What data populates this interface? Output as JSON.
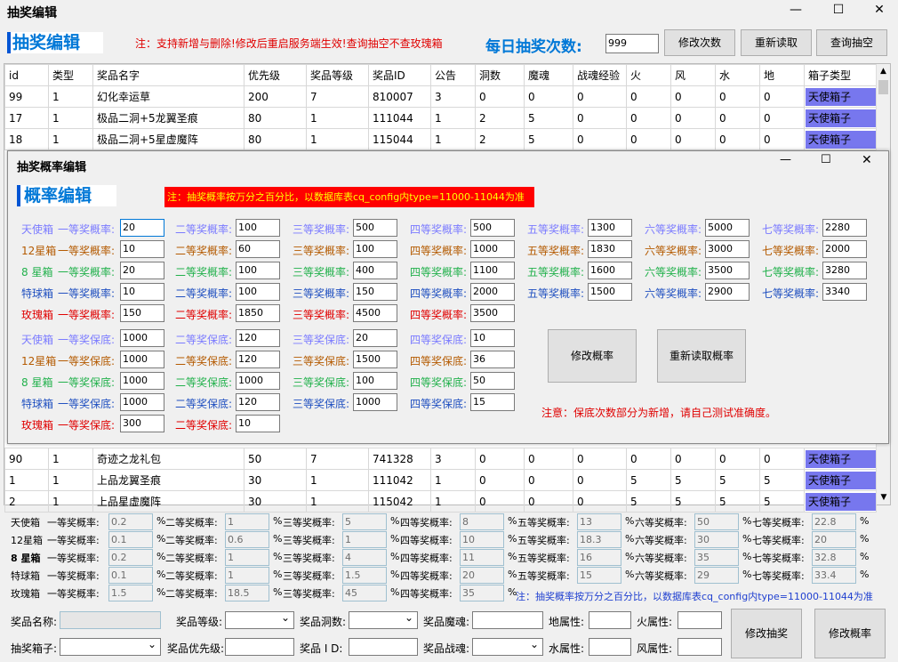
{
  "window": {
    "title": "抽奖编辑"
  },
  "top": {
    "heading": "抽奖编辑",
    "note": "注：支持新增与删除!修改后重启服务端生效!查询抽空不查玫瑰箱",
    "daily_label": "每日抽奖次数:",
    "daily_value": "999",
    "btn_modify": "修改次数",
    "btn_reload": "重新读取",
    "btn_query": "查询抽空"
  },
  "table": {
    "headers": [
      "id",
      "类型",
      "奖品名字",
      "优先级",
      "奖品等级",
      "奖品ID",
      "公告",
      "洞数",
      "魔魂",
      "战魂经验",
      "火",
      "风",
      "水",
      "地",
      "箱子类型"
    ],
    "rows_top": [
      [
        "99",
        "1",
        "幻化幸运草",
        "200",
        "7",
        "810007",
        "3",
        "0",
        "0",
        "0",
        "0",
        "0",
        "0",
        "0",
        "天使箱子"
      ],
      [
        "17",
        "1",
        "极品二洞+5龙翼圣痕",
        "80",
        "1",
        "111044",
        "1",
        "2",
        "5",
        "0",
        "0",
        "0",
        "0",
        "0",
        "天使箱子"
      ],
      [
        "18",
        "1",
        "极品二洞+5星虚魔阵",
        "80",
        "1",
        "115044",
        "1",
        "2",
        "5",
        "0",
        "0",
        "0",
        "0",
        "0",
        "天使箱子"
      ]
    ],
    "rows_bottom": [
      [
        "90",
        "1",
        "奇迹之龙礼包",
        "50",
        "7",
        "741328",
        "3",
        "0",
        "0",
        "0",
        "0",
        "0",
        "0",
        "0",
        "天使箱子"
      ],
      [
        "1",
        "1",
        "上品龙翼圣痕",
        "30",
        "1",
        "111042",
        "1",
        "0",
        "0",
        "0",
        "5",
        "5",
        "5",
        "5",
        "天使箱子"
      ],
      [
        "2",
        "1",
        "上品星虚魔阵",
        "30",
        "1",
        "115042",
        "1",
        "0",
        "0",
        "0",
        "5",
        "5",
        "5",
        "5",
        "天使箱子"
      ]
    ]
  },
  "dialog": {
    "title": "抽奖概率编辑",
    "heading": "概率编辑",
    "note": "注：抽奖概率按万分之百分比，以数据库表cq_config内type=11000-11044为准",
    "rows": [
      {
        "box": "天使箱",
        "cls": "c-tianshi",
        "labels": [
          "一等奖概率:",
          "二等奖概率:",
          "三等奖概率:",
          "四等奖概率:",
          "五等奖概率:",
          "六等奖概率:",
          "七等奖概率:"
        ],
        "values": [
          "20",
          "100",
          "500",
          "500",
          "1300",
          "5000",
          "2280"
        ]
      },
      {
        "box": "12星箱",
        "cls": "c-12",
        "labels": [
          "一等奖概率:",
          "二等奖概率:",
          "三等奖概率:",
          "四等奖概率:",
          "五等奖概率:",
          "六等奖概率:",
          "七等奖概率:"
        ],
        "values": [
          "10",
          "60",
          "100",
          "1000",
          "1830",
          "3000",
          "2000"
        ]
      },
      {
        "box": "8 星箱",
        "cls": "c-8",
        "labels": [
          "一等奖概率:",
          "二等奖概率:",
          "三等奖概率:",
          "四等奖概率:",
          "五等奖概率:",
          "六等奖概率:",
          "七等奖概率:"
        ],
        "values": [
          "20",
          "100",
          "400",
          "1100",
          "1600",
          "3500",
          "3280"
        ]
      },
      {
        "box": "特球箱",
        "cls": "c-teqiu",
        "labels": [
          "一等奖概率:",
          "二等奖概率:",
          "三等奖概率:",
          "四等奖概率:",
          "五等奖概率:",
          "六等奖概率:",
          "七等奖概率:"
        ],
        "values": [
          "10",
          "100",
          "150",
          "2000",
          "1500",
          "2900",
          "3340"
        ]
      },
      {
        "box": "玫瑰箱",
        "cls": "c-meigui",
        "labels": [
          "一等奖概率:",
          "二等奖概率:",
          "三等奖概率:",
          "四等奖概率:"
        ],
        "values": [
          "150",
          "1850",
          "4500",
          "3500"
        ]
      }
    ],
    "floor_rows": [
      {
        "box": "天使箱",
        "cls": "c-tianshi",
        "labels": [
          "一等奖保底:",
          "二等奖保底:",
          "三等奖保底:",
          "四等奖保底:"
        ],
        "values": [
          "1000",
          "120",
          "20",
          "10"
        ]
      },
      {
        "box": "12星箱",
        "cls": "c-12",
        "labels": [
          "一等奖保底:",
          "二等奖保底:",
          "三等奖保底:",
          "四等奖保底:"
        ],
        "values": [
          "1000",
          "120",
          "1500",
          "36"
        ]
      },
      {
        "box": "8 星箱",
        "cls": "c-8",
        "labels": [
          "一等奖保底:",
          "二等奖保底:",
          "三等奖保底:",
          "四等奖保底:"
        ],
        "values": [
          "1000",
          "1000",
          "100",
          "50"
        ]
      },
      {
        "box": "特球箱",
        "cls": "c-teqiu",
        "labels": [
          "一等奖保底:",
          "二等奖保底:",
          "三等奖保底:",
          "四等奖保底:"
        ],
        "values": [
          "1000",
          "120",
          "1000",
          "15"
        ]
      },
      {
        "box": "玫瑰箱",
        "cls": "c-meigui",
        "labels": [
          "一等奖保底:",
          "二等奖保底:"
        ],
        "values": [
          "300",
          "10"
        ]
      }
    ],
    "btn_modify": "修改概率",
    "btn_reload": "重新读取概率",
    "floor_note": "注意：保底次数部分为新增，请自己测试准确度。"
  },
  "bottom": {
    "pct": "%",
    "rows": [
      {
        "box": "天使箱",
        "labels": [
          "一等奖概率:",
          "二等奖概率:",
          "三等奖概率:",
          "四等奖概率:",
          "五等奖概率:",
          "六等奖概率:",
          "七等奖概率:"
        ],
        "values": [
          "0.2",
          "1",
          "5",
          "8",
          "13",
          "50",
          "22.8"
        ]
      },
      {
        "box": "12星箱",
        "labels": [
          "一等奖概率:",
          "二等奖概率:",
          "三等奖概率:",
          "四等奖概率:",
          "五等奖概率:",
          "六等奖概率:",
          "七等奖概率:"
        ],
        "values": [
          "0.1",
          "0.6",
          "1",
          "10",
          "18.3",
          "30",
          "20"
        ]
      },
      {
        "box": "8 星箱",
        "labels": [
          "一等奖概率:",
          "二等奖概率:",
          "三等奖概率:",
          "四等奖概率:",
          "五等奖概率:",
          "六等奖概率:",
          "七等奖概率:"
        ],
        "values": [
          "0.2",
          "1",
          "4",
          "11",
          "16",
          "35",
          "32.8"
        ]
      },
      {
        "box": "特球箱",
        "labels": [
          "一等奖概率:",
          "二等奖概率:",
          "三等奖概率:",
          "四等奖概率:",
          "五等奖概率:",
          "六等奖概率:",
          "七等奖概率:"
        ],
        "values": [
          "0.1",
          "1",
          "1.5",
          "20",
          "15",
          "29",
          "33.4"
        ]
      },
      {
        "box": "玫瑰箱",
        "labels": [
          "一等奖概率:",
          "二等奖概率:",
          "三等奖概率:",
          "四等奖概率:"
        ],
        "values": [
          "1.5",
          "18.5",
          "45",
          "35"
        ]
      }
    ],
    "note": "注：抽奖概率按万分之百分比，以数据库表cq_config内type=11000-11044为准"
  },
  "form": {
    "name": "奖品名称:",
    "level": "奖品等级:",
    "holes": "奖品洞数:",
    "mohun": "奖品魔魂:",
    "earth": "地属性:",
    "fire": "火属性:",
    "box": "抽奖箱子:",
    "priority": "奖品优先级:",
    "id": "奖品 I D:",
    "zhanhun": "奖品战魂:",
    "water": "水属性:",
    "wind": "风属性:",
    "btn_draw": "修改抽奖",
    "btn_prob": "修改概率"
  }
}
